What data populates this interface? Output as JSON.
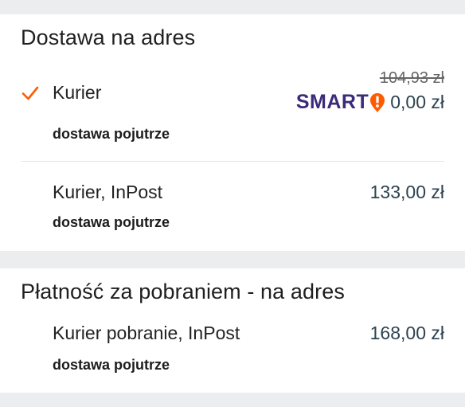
{
  "colors": {
    "page_background": "#ebedef",
    "card_background": "#ffffff",
    "check_accent": "#ff5a00",
    "price_text": "#2d4250",
    "smart_brand": "#3c2a7a",
    "smart_badge": "#ff5a00"
  },
  "address_section": {
    "title": "Dostawa na adres",
    "options": [
      {
        "name": "Kurier",
        "subtitle": "dostawa pojutrze",
        "selected": true,
        "old_price": "104,93 zł",
        "smart_label": "SMART",
        "smart_icon": "smart-badge-icon",
        "price": "0,00 zł"
      },
      {
        "name": "Kurier, InPost",
        "subtitle": "dostawa pojutrze",
        "selected": false,
        "price": "133,00 zł"
      }
    ]
  },
  "cod_section": {
    "title": "Płatność za pobraniem - na adres",
    "options": [
      {
        "name": "Kurier pobranie, InPost",
        "subtitle": "dostawa pojutrze",
        "selected": false,
        "price": "168,00 zł"
      }
    ]
  },
  "icons": {
    "check": "checkmark-icon",
    "smart": "smart-badge-icon"
  }
}
